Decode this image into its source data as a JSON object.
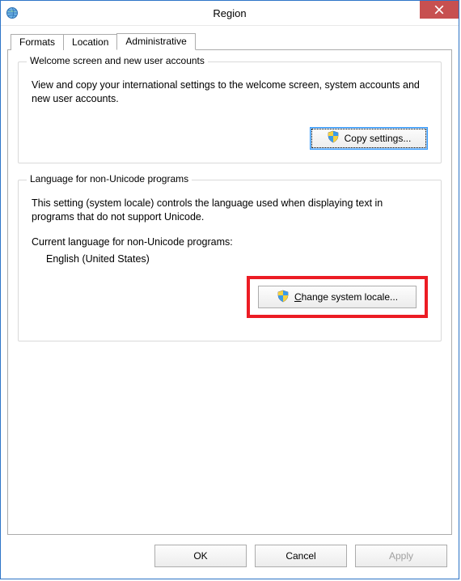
{
  "window": {
    "title": "Region"
  },
  "tabs": {
    "formats": "Formats",
    "location": "Location",
    "administrative": "Administrative"
  },
  "group1": {
    "legend": "Welcome screen and new user accounts",
    "text": "View and copy your international settings to the welcome screen, system accounts and new user accounts.",
    "button": "Copy settings..."
  },
  "group2": {
    "legend": "Language for non-Unicode programs",
    "text": "This setting (system locale) controls the language used when displaying text in programs that do not support Unicode.",
    "current_label": "Current language for non-Unicode programs:",
    "current_value": "English (United States)",
    "button_prefix": "C",
    "button_rest": "hange system locale..."
  },
  "buttons": {
    "ok": "OK",
    "cancel": "Cancel",
    "apply": "Apply"
  }
}
